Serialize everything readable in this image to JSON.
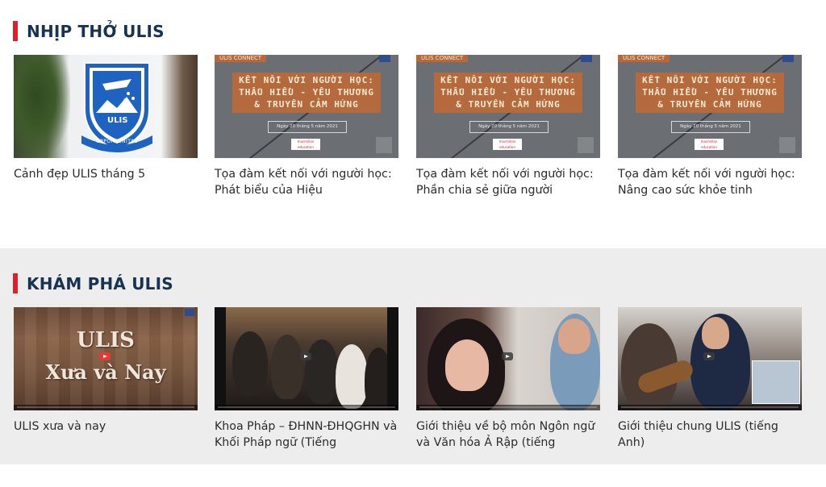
{
  "sections": [
    {
      "title": "NHỊP THỞ ULIS",
      "cards": [
        {
          "caption": "Cảnh đẹp ULIS tháng 5",
          "thumb_type": "ulis-logo-photo",
          "logo_text": "ULIS",
          "motto": "OPPORTUNITAS"
        },
        {
          "caption": "Tọa đàm kết nối với người học: Phát biểu của Hiệu",
          "thumb_type": "connect-banner"
        },
        {
          "caption": "Tọa đàm kết nối với người học: Phần chia sẻ giữa người",
          "thumb_type": "connect-banner"
        },
        {
          "caption": "Tọa đàm kết nối với người học: Nâng cao sức khỏe tinh",
          "thumb_type": "connect-banner"
        }
      ]
    },
    {
      "title": "KHÁM PHÁ ULIS",
      "cards": [
        {
          "caption": "ULIS xưa và nay",
          "thumb_type": "video",
          "overlay_line1": "ULIS",
          "overlay_line2": "Xưa và Nay"
        },
        {
          "caption": "Khoa Pháp – ĐHNN-ĐHQGHN và Khối Pháp ngữ (Tiếng",
          "thumb_type": "video"
        },
        {
          "caption": "Giới thiệu về bộ môn Ngôn ngữ và Văn hóa Ả Rập (tiếng",
          "thumb_type": "video"
        },
        {
          "caption": "Giới thiệu chung ULIS (tiếng Anh)",
          "thumb_type": "video"
        }
      ]
    }
  ],
  "connect_banner": {
    "tag": "ULIS CONNECT",
    "line1": "KẾT NỐI VỚI NGƯỜI HỌC:",
    "line2": "THẤU HIỂU - YÊU THƯƠNG",
    "line3": "& TRUYỀN CẢM HỨNG",
    "date": "Ngày 20 tháng 5 năm 2021",
    "sponsor": "macmillan education"
  },
  "colors": {
    "accent": "#d8232a",
    "title": "#18334f",
    "section2_bg": "#ededed"
  }
}
